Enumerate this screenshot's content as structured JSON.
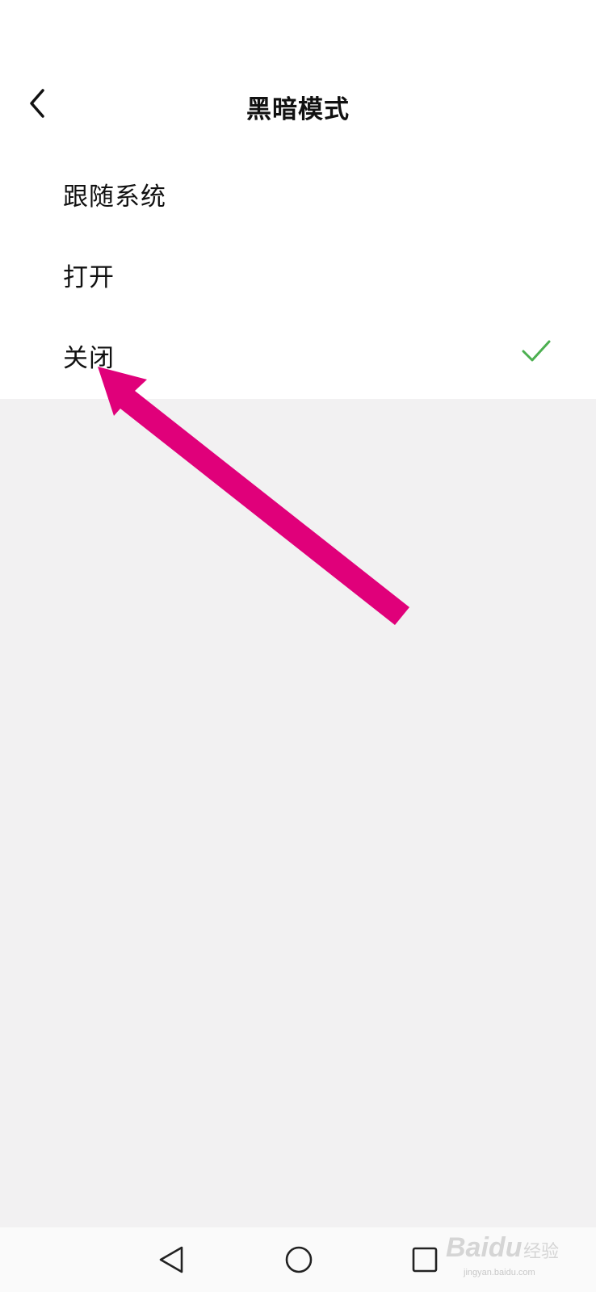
{
  "header": {
    "title": "黑暗模式",
    "back_icon": "chevron-left-icon"
  },
  "options": [
    {
      "label": "跟随系统",
      "selected": false
    },
    {
      "label": "打开",
      "selected": false
    },
    {
      "label": "关闭",
      "selected": true
    }
  ],
  "check_icon": "checkmark-icon",
  "colors": {
    "page_bg": "#f2f1f2",
    "panel_bg": "#ffffff",
    "check": "#4caf50",
    "annotation_arrow": "#e0007a"
  },
  "navbar": {
    "back_icon": "triangle-back-icon",
    "home_icon": "circle-home-icon",
    "recents_icon": "square-recents-icon"
  },
  "watermark": {
    "logo": "Bai",
    "logo2": "du",
    "cn": "经验",
    "url": "jingyan.baidu.com"
  }
}
